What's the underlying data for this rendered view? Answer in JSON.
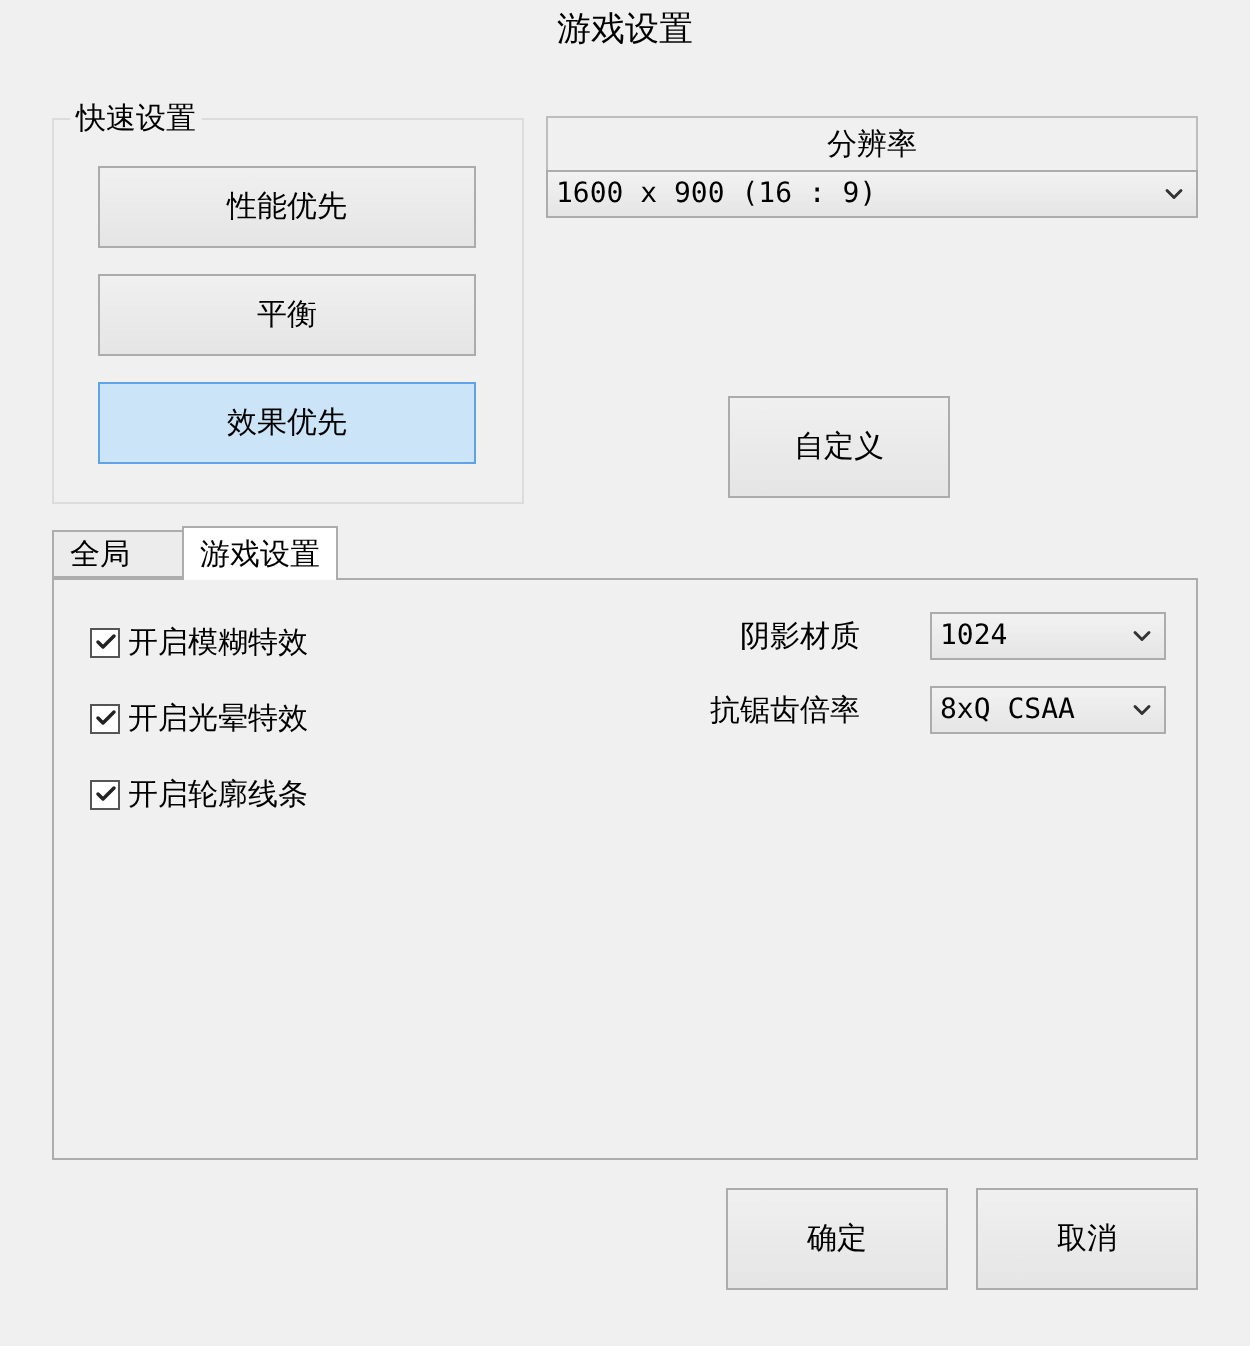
{
  "window": {
    "title": "游戏设置"
  },
  "quick_settings": {
    "title": "快速设置",
    "presets": [
      {
        "label": "性能优先",
        "selected": false
      },
      {
        "label": "平衡",
        "selected": false
      },
      {
        "label": "效果优先",
        "selected": true
      }
    ]
  },
  "resolution": {
    "header": "分辨率",
    "value": "1600 x 900 (16 : 9)"
  },
  "custom_button": "自定义",
  "tabs": [
    {
      "label": "全局",
      "selected": false
    },
    {
      "label": "游戏设置",
      "selected": true
    }
  ],
  "options": [
    {
      "label": "开启模糊特效",
      "checked": true
    },
    {
      "label": "开启光晕特效",
      "checked": true
    },
    {
      "label": "开启轮廓线条",
      "checked": true
    }
  ],
  "settings": [
    {
      "label": "阴影材质",
      "value": "1024"
    },
    {
      "label": "抗锯齿倍率",
      "value": "8xQ CSAA"
    }
  ],
  "buttons": [
    "确定",
    "取消"
  ]
}
